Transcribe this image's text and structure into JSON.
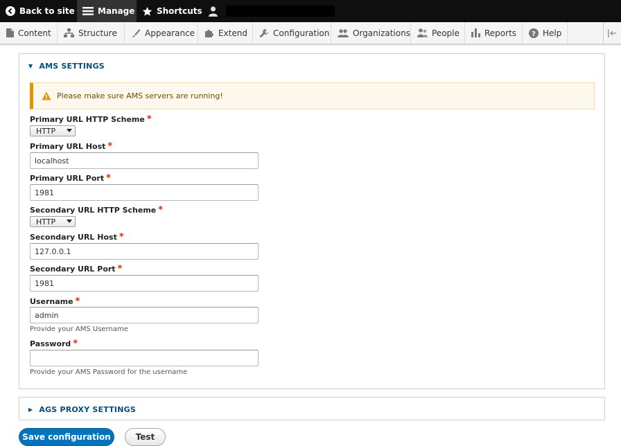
{
  "toolbar": {
    "back_label": "Back to site",
    "manage_label": "Manage",
    "shortcuts_label": "Shortcuts"
  },
  "tray": {
    "items": [
      {
        "label": "Content",
        "icon": "file-icon"
      },
      {
        "label": "Structure",
        "icon": "sitemap-icon"
      },
      {
        "label": "Appearance",
        "icon": "brush-icon"
      },
      {
        "label": "Extend",
        "icon": "puzzle-icon"
      },
      {
        "label": "Configuration",
        "icon": "wrench-icon"
      },
      {
        "label": "Organizations",
        "icon": "group-icon"
      },
      {
        "label": "People",
        "icon": "people-icon"
      },
      {
        "label": "Reports",
        "icon": "bar-chart-icon"
      },
      {
        "label": "Help",
        "icon": "help-icon"
      }
    ]
  },
  "ams": {
    "title": "AMS SETTINGS",
    "warning": "Please make sure AMS servers are running!",
    "fields": {
      "primary_scheme": {
        "label": "Primary URL HTTP Scheme",
        "value": "HTTP"
      },
      "primary_host": {
        "label": "Primary URL Host",
        "value": "localhost"
      },
      "primary_port": {
        "label": "Primary URL Port",
        "value": "1981"
      },
      "secondary_scheme": {
        "label": "Secondary URL HTTP Scheme",
        "value": "HTTP"
      },
      "secondary_host": {
        "label": "Secondary URL Host",
        "value": "127.0.0.1"
      },
      "secondary_port": {
        "label": "Secondary URL Port",
        "value": "1981"
      },
      "username": {
        "label": "Username",
        "value": "admin",
        "description": "Provide your AMS Username"
      },
      "password": {
        "label": "Password",
        "value": "",
        "description": "Provide your AMS Password for the username"
      }
    },
    "required_mark": "*"
  },
  "ags": {
    "title": "AGS PROXY SETTINGS"
  },
  "actions": {
    "save_label": "Save configuration",
    "test_label": "Test"
  },
  "colors": {
    "link": "#004f80",
    "primary_button": "#0074bd",
    "required": "#e62600",
    "warning_border": "#e09600"
  }
}
